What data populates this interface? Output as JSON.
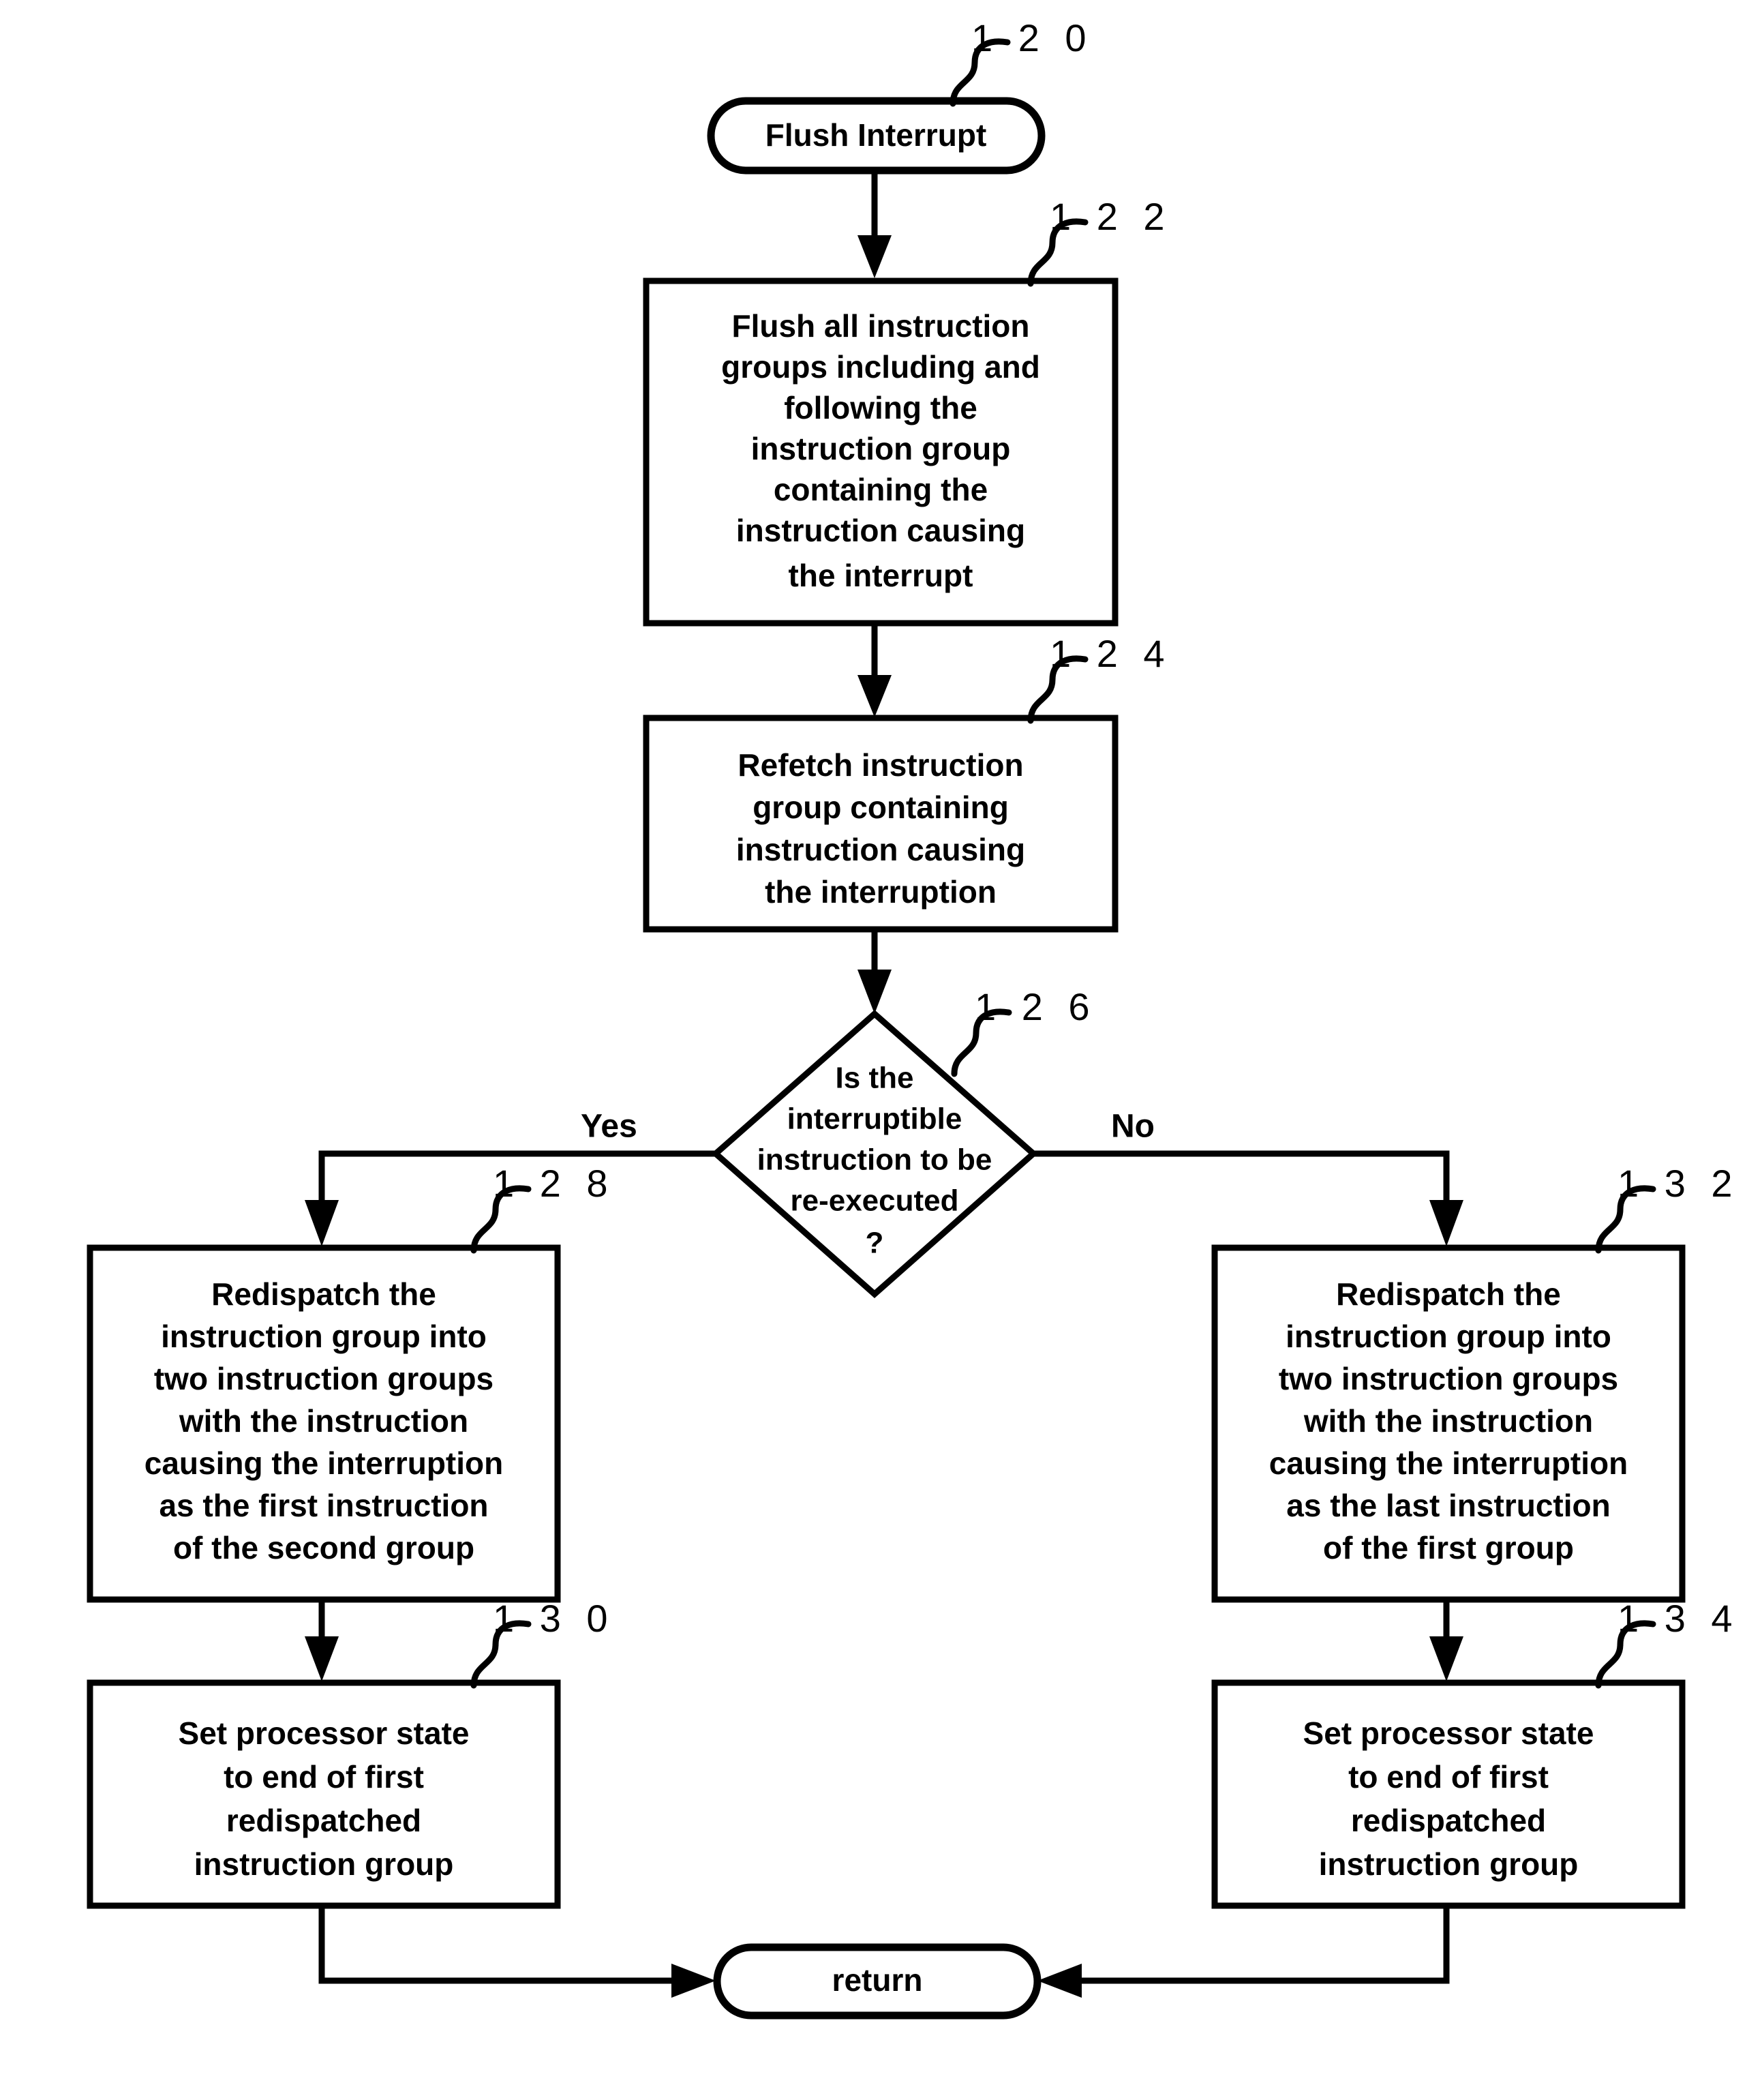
{
  "diagram": {
    "type": "flowchart",
    "title": "Flush Interrupt handling flowchart",
    "line_color": "#000000",
    "fill_color": "#ffffff"
  },
  "nodes": {
    "start": {
      "ref": "1 2 0",
      "shape": "terminator",
      "label": "Flush Interrupt",
      "lines": [
        "Flush Interrupt"
      ]
    },
    "flush_all": {
      "ref": "1 2 2",
      "shape": "process",
      "lines": [
        "Flush all instruction",
        "groups including and",
        "following the",
        "instruction group",
        "containing the",
        "instruction causing",
        "the interrupt"
      ]
    },
    "refetch": {
      "ref": "1 2 4",
      "shape": "process",
      "lines": [
        "Refetch instruction",
        "group containing",
        "instruction causing",
        "the interruption"
      ]
    },
    "decision": {
      "ref": "1 2 6",
      "shape": "decision",
      "lines": [
        "Is the",
        "interruptible",
        "instruction to be",
        "re-executed",
        "?"
      ],
      "yes_label": "Yes",
      "no_label": "No"
    },
    "redispatch_first": {
      "ref": "1 2 8",
      "shape": "process",
      "lines": [
        "Redispatch the",
        "instruction group into",
        "two instruction groups",
        "with the instruction",
        "causing the interruption",
        "as the first instruction",
        "of the second group"
      ]
    },
    "redispatch_last": {
      "ref": "1 3 2",
      "shape": "process",
      "lines": [
        "Redispatch the",
        "instruction group into",
        "two instruction groups",
        "with the instruction",
        "causing the interruption",
        "as the last instruction",
        "of the first group"
      ]
    },
    "set_state_left": {
      "ref": "1 3 0",
      "shape": "process",
      "lines": [
        "Set processor state",
        "to end of first",
        "redispatched",
        "instruction group"
      ]
    },
    "set_state_right": {
      "ref": "1 3 4",
      "shape": "process",
      "lines": [
        "Set processor state",
        "to end of first",
        "redispatched",
        "instruction group"
      ]
    },
    "end": {
      "shape": "terminator",
      "label": "return",
      "lines": [
        "return"
      ]
    }
  },
  "edges": [
    {
      "from": "start",
      "to": "flush_all",
      "label": ""
    },
    {
      "from": "flush_all",
      "to": "refetch",
      "label": ""
    },
    {
      "from": "refetch",
      "to": "decision",
      "label": ""
    },
    {
      "from": "decision",
      "to": "redispatch_first",
      "label": "Yes"
    },
    {
      "from": "decision",
      "to": "redispatch_last",
      "label": "No"
    },
    {
      "from": "redispatch_first",
      "to": "set_state_left",
      "label": ""
    },
    {
      "from": "redispatch_last",
      "to": "set_state_right",
      "label": ""
    },
    {
      "from": "set_state_left",
      "to": "end",
      "label": ""
    },
    {
      "from": "set_state_right",
      "to": "end",
      "label": ""
    }
  ]
}
